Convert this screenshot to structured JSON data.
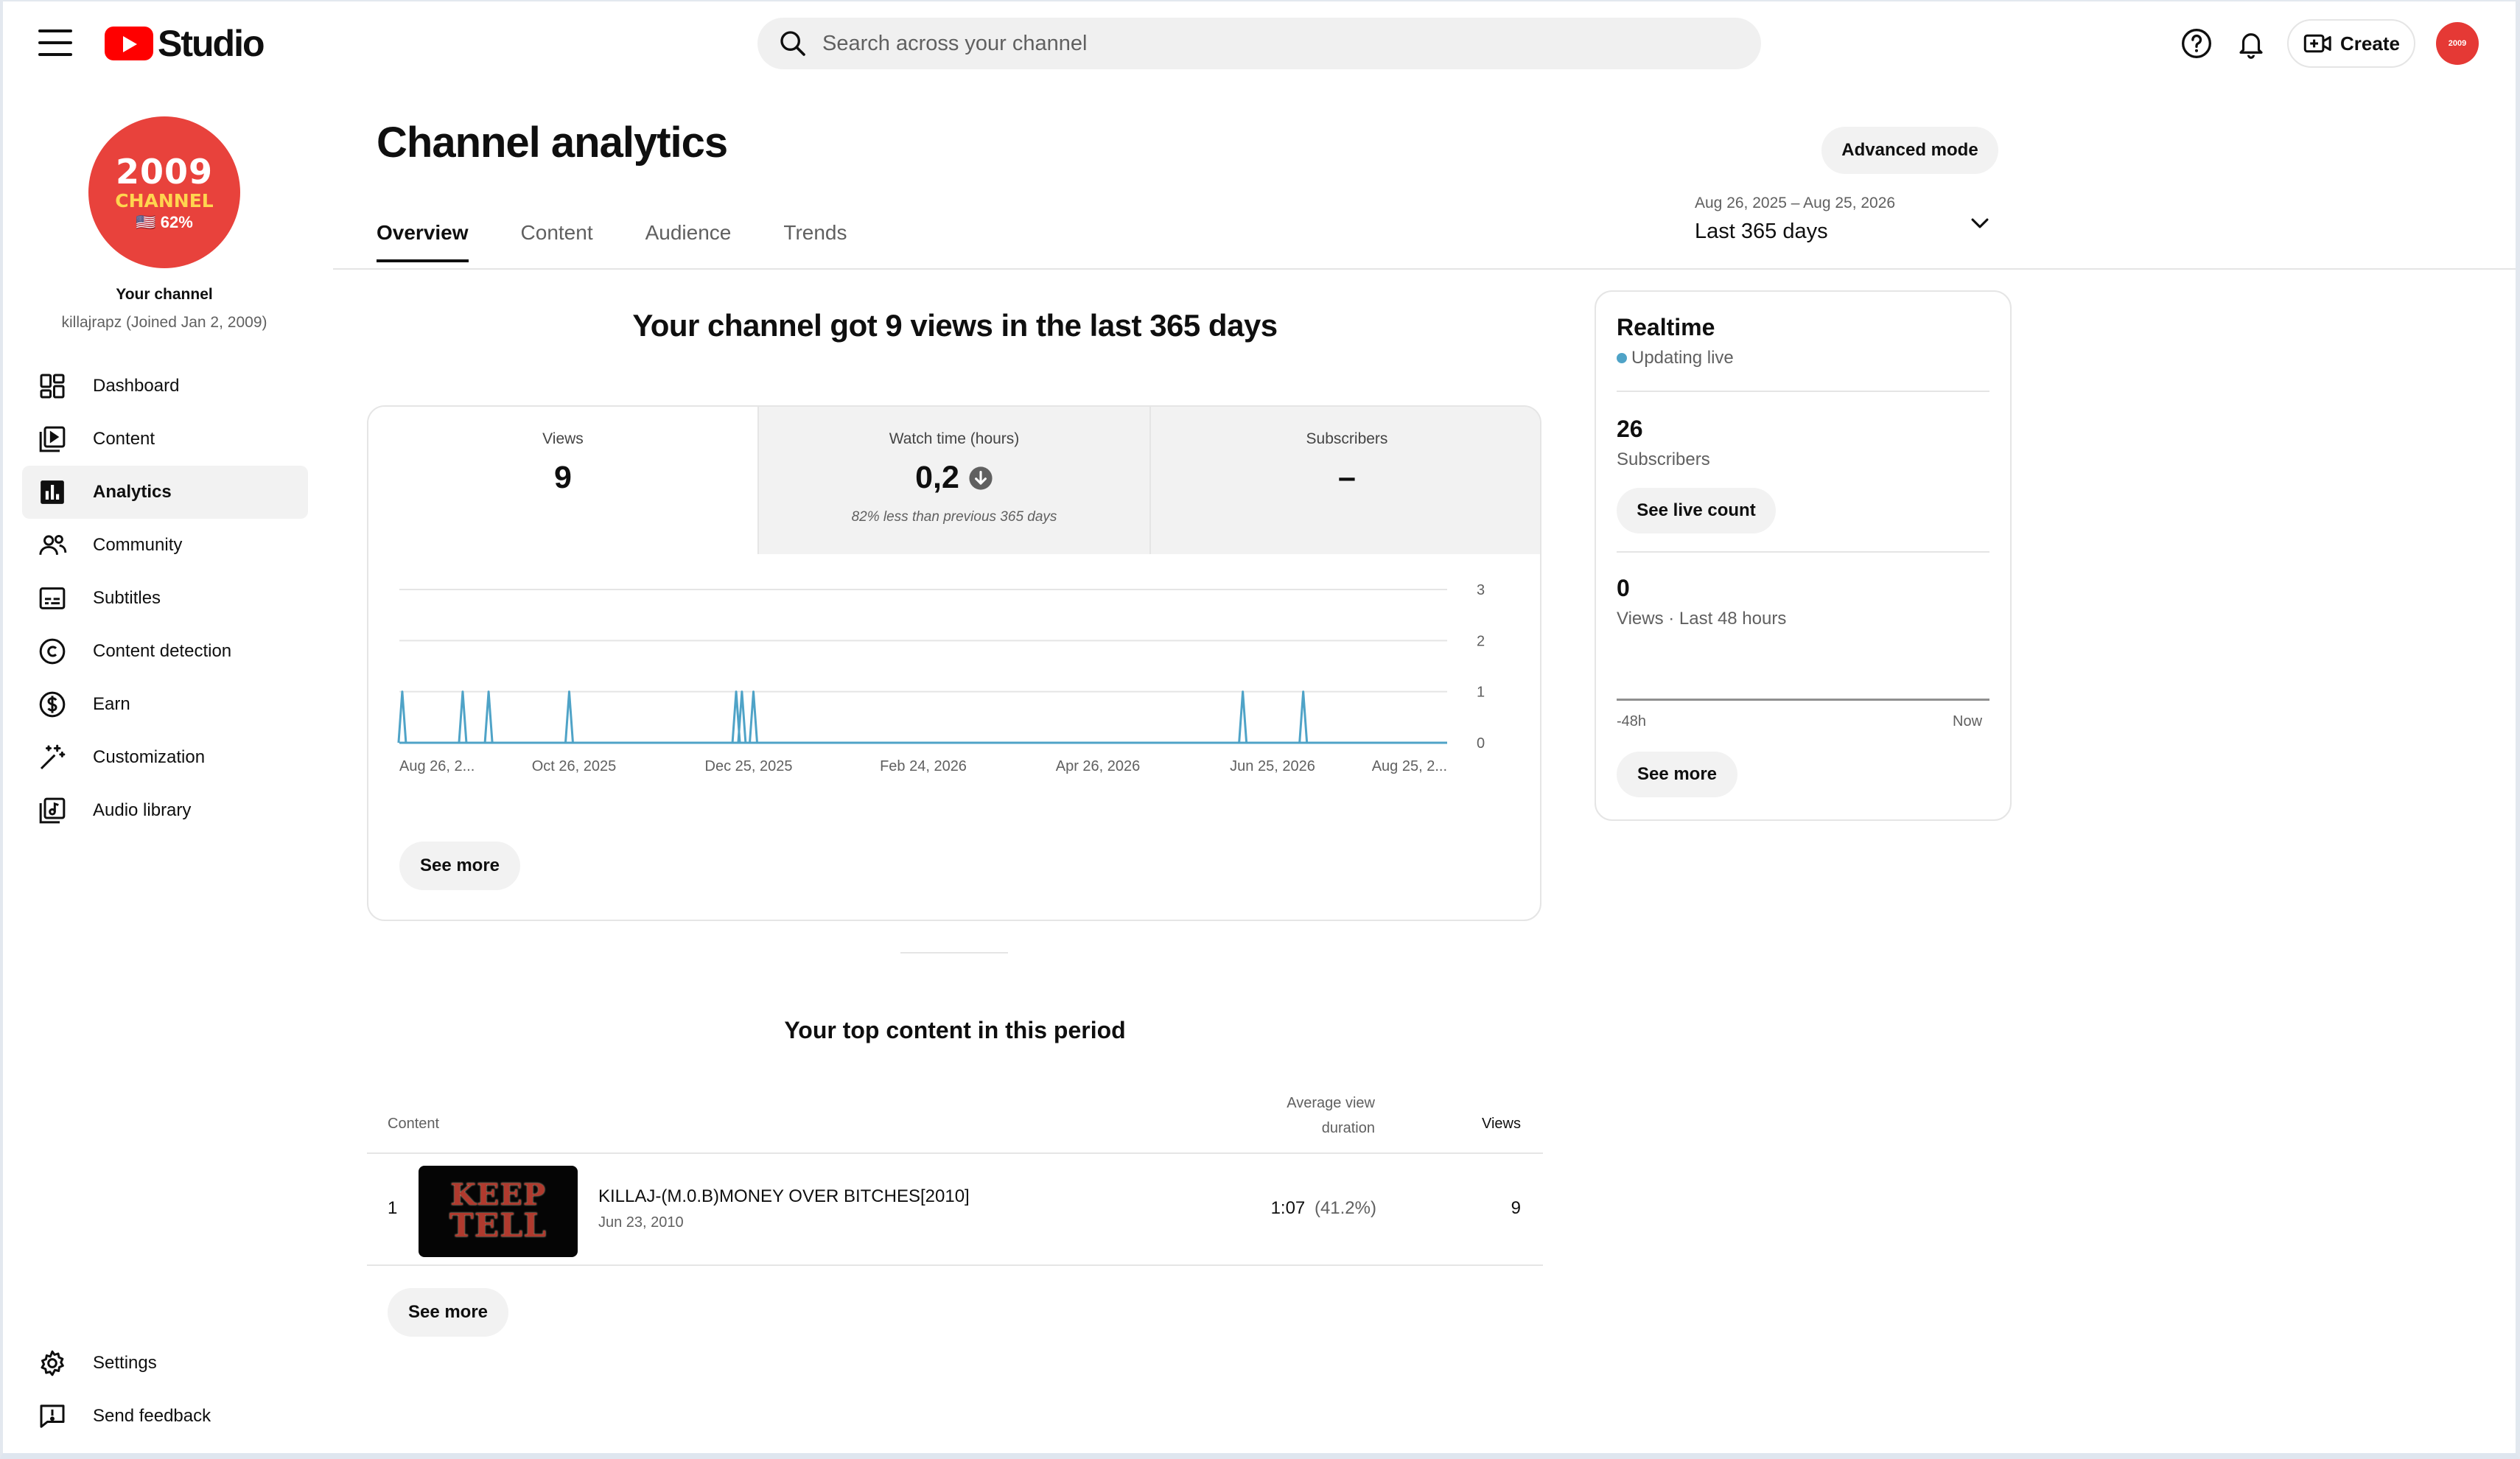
{
  "header": {
    "studio_label": "Studio",
    "search_placeholder": "Search across your channel",
    "create_label": "Create",
    "avatar_text": "2009"
  },
  "channel": {
    "avatar_year": "2009",
    "avatar_word": "CHANNEL",
    "avatar_pct": "🇺🇸 62%",
    "label": "Your channel",
    "handle": "killajrapz (Joined Jan 2, 2009)"
  },
  "nav": {
    "items": [
      {
        "label": "Dashboard",
        "icon": "dashboard-icon"
      },
      {
        "label": "Content",
        "icon": "content-icon"
      },
      {
        "label": "Analytics",
        "icon": "analytics-icon",
        "active": true
      },
      {
        "label": "Community",
        "icon": "community-icon"
      },
      {
        "label": "Subtitles",
        "icon": "subtitles-icon"
      },
      {
        "label": "Content detection",
        "icon": "copyright-icon"
      },
      {
        "label": "Earn",
        "icon": "dollar-icon"
      },
      {
        "label": "Customization",
        "icon": "magic-wand-icon"
      },
      {
        "label": "Audio library",
        "icon": "audio-library-icon"
      }
    ],
    "bottom": [
      {
        "label": "Settings",
        "icon": "gear-icon"
      },
      {
        "label": "Send feedback",
        "icon": "feedback-icon"
      }
    ]
  },
  "page": {
    "title": "Channel analytics",
    "advanced_mode": "Advanced mode",
    "tabs": [
      "Overview",
      "Content",
      "Audience",
      "Trends"
    ],
    "date_range": {
      "dates": "Aug 26, 2025 – Aug 25, 2026",
      "label": "Last 365 days"
    },
    "headline": "Your channel got 9 views in the last 365 days"
  },
  "metrics": [
    {
      "label": "Views",
      "value": "9",
      "note": ""
    },
    {
      "label": "Watch time (hours)",
      "value": "0,2",
      "note": "82% less than previous 365 days"
    },
    {
      "label": "Subscribers",
      "value": "–",
      "note": ""
    }
  ],
  "chart_data": {
    "type": "line",
    "title": "",
    "xlabel": "",
    "ylabel": "",
    "ylim": [
      0,
      3
    ],
    "yticks": [
      "3",
      "2",
      "1",
      "0"
    ],
    "xticks": [
      "Aug 26, 2...",
      "Oct 26, 2025",
      "Dec 25, 2025",
      "Feb 24, 2026",
      "Apr 26, 2026",
      "Jun 25, 2026",
      "Aug 25, 2..."
    ],
    "x_start": "2025-08-26",
    "x_end": "2026-08-25",
    "spikes": [
      {
        "date": "2025-08-27",
        "value": 1
      },
      {
        "date": "2025-09-17",
        "value": 1
      },
      {
        "date": "2025-09-26",
        "value": 1
      },
      {
        "date": "2025-10-24",
        "value": 1
      },
      {
        "date": "2025-12-21",
        "value": 1
      },
      {
        "date": "2025-12-23",
        "value": 1
      },
      {
        "date": "2025-12-27",
        "value": 1
      },
      {
        "date": "2026-06-15",
        "value": 1
      },
      {
        "date": "2026-07-06",
        "value": 1
      }
    ],
    "color": "#4fa3c7",
    "grid": true
  },
  "see_more": "See more",
  "realtime": {
    "title": "Realtime",
    "status": "Updating live",
    "subs_value": "26",
    "subs_label": "Subscribers",
    "live_count_btn": "See live count",
    "views_value": "0",
    "views_label": "Views · Last 48 hours",
    "axis_start": "-48h",
    "axis_end": "Now",
    "see_more": "See more"
  },
  "top_content": {
    "title": "Your top content in this period",
    "col_content": "Content",
    "col_avg": "Average view duration",
    "col_avg_1": "Average view",
    "col_avg_2": "duration",
    "col_views": "Views",
    "rows": [
      {
        "rank": "1",
        "title": "KILLAJ-(M.0.B)MONEY OVER BITCHES[2010]",
        "date": "Jun 23, 2010",
        "avg": "1:07",
        "pct": "(41.2%)",
        "views": "9",
        "thumb_top": "KEEP",
        "thumb_bottom": "TELL"
      }
    ],
    "see_more": "See more"
  },
  "colors": {
    "accent": "#ff0000",
    "chart_line": "#4fa3c7",
    "live_dot": "#4fa3c7"
  }
}
